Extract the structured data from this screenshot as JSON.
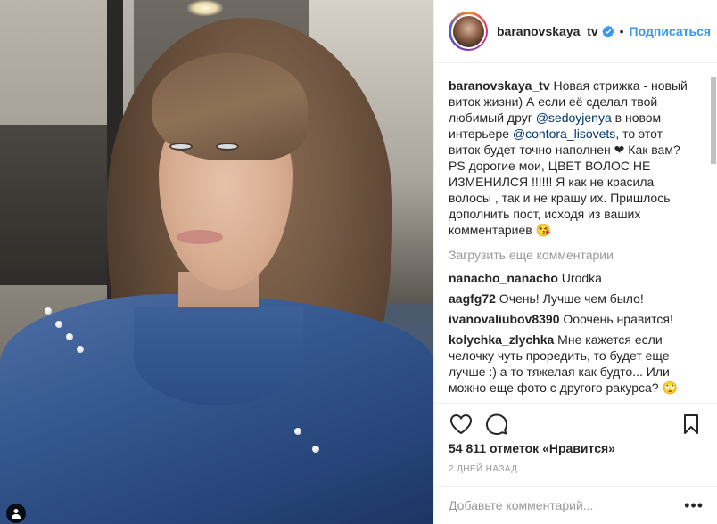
{
  "header": {
    "username": "baranovskaya_tv",
    "separator": "•",
    "follow_label": "Подписаться"
  },
  "caption": {
    "username": "baranovskaya_tv",
    "text_1": " Новая стрижка - новый виток жизни) А если её сделал твой любимый друг ",
    "mention_1": "@sedoyjenya",
    "text_2": " в новом интерьере ",
    "mention_2": "@contora_lisovets",
    "text_3": ", то этот виток будет точно наполнен ❤ Как вам? PS дорогие мои, ЦВЕТ ВОЛОС НЕ ИЗМЕНИЛСЯ !!!!!! Я как не красила волосы , так и не крашу их. Пришлось дополнить пост, исходя из ваших комментариев 😘"
  },
  "load_more_label": "Загрузить еще комментарии",
  "comments": [
    {
      "user": "nanacho_nanacho",
      "text": " Urodka"
    },
    {
      "user": "aagfg72",
      "text": " Очень! Лучше чем было!"
    },
    {
      "user": "ivanovaliubov8390",
      "text": " Ооочень нравится!"
    },
    {
      "user": "kolychka_zlychka",
      "text": " Мне кажется если челочку чуть проредить, то будет еще лучше :) а то тяжелая как будто... Или можно еще фото с другого ракурса? 🙄"
    }
  ],
  "likes": "54 811 отметок «Нравится»",
  "time": "2 ДНЕЙ НАЗАД",
  "add_comment_placeholder": "Добавьте комментарий...",
  "more_label": "•••",
  "icons": {
    "like": "heart-icon",
    "comment": "comment-icon",
    "save": "bookmark-icon",
    "verified": "verified-badge-icon",
    "tag": "person-tag-icon"
  },
  "colors": {
    "link": "#3897f0",
    "mention": "#003569",
    "muted": "#999999",
    "text": "#262626"
  }
}
